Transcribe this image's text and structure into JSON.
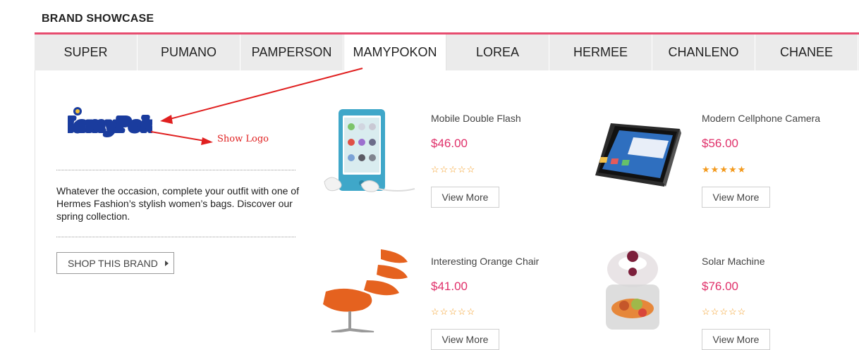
{
  "section": {
    "title": "BRAND SHOWCASE"
  },
  "tabs": [
    {
      "label": "SUPER"
    },
    {
      "label": "PUMANO"
    },
    {
      "label": "PAMPERSON"
    },
    {
      "label": "MAMYPOKON",
      "active": true
    },
    {
      "label": "LOREA"
    },
    {
      "label": "HERMEE"
    },
    {
      "label": "CHANLENO"
    },
    {
      "label": "CHANEE"
    }
  ],
  "brand": {
    "logo_text": "MamyPoko",
    "annotation": "Show Logo",
    "description": "Whatever the occasion, complete your outfit with one of Hermes Fashion’s stylish women’s bags. Discover our spring collection.",
    "shop_button": "SHOP THIS BRAND"
  },
  "products": [
    {
      "name": "Mobile Double Flash",
      "price": "$46.00",
      "rating": 0,
      "button": "View More",
      "image": "ipod-nano-image"
    },
    {
      "name": "Modern Cellphone Camera",
      "price": "$56.00",
      "rating": 5,
      "button": "View More",
      "image": "tablet-image"
    },
    {
      "name": "Interesting Orange Chair",
      "price": "$41.00",
      "rating": 0,
      "button": "View More",
      "image": "orange-chair-image"
    },
    {
      "name": "Solar Machine",
      "price": "$76.00",
      "rating": 0,
      "button": "View More",
      "image": "halogen-oven-image"
    }
  ],
  "colors": {
    "accent": "#e74c6f",
    "price": "#e0306a",
    "star": "#f39a1e",
    "annotation": "#e02020"
  }
}
